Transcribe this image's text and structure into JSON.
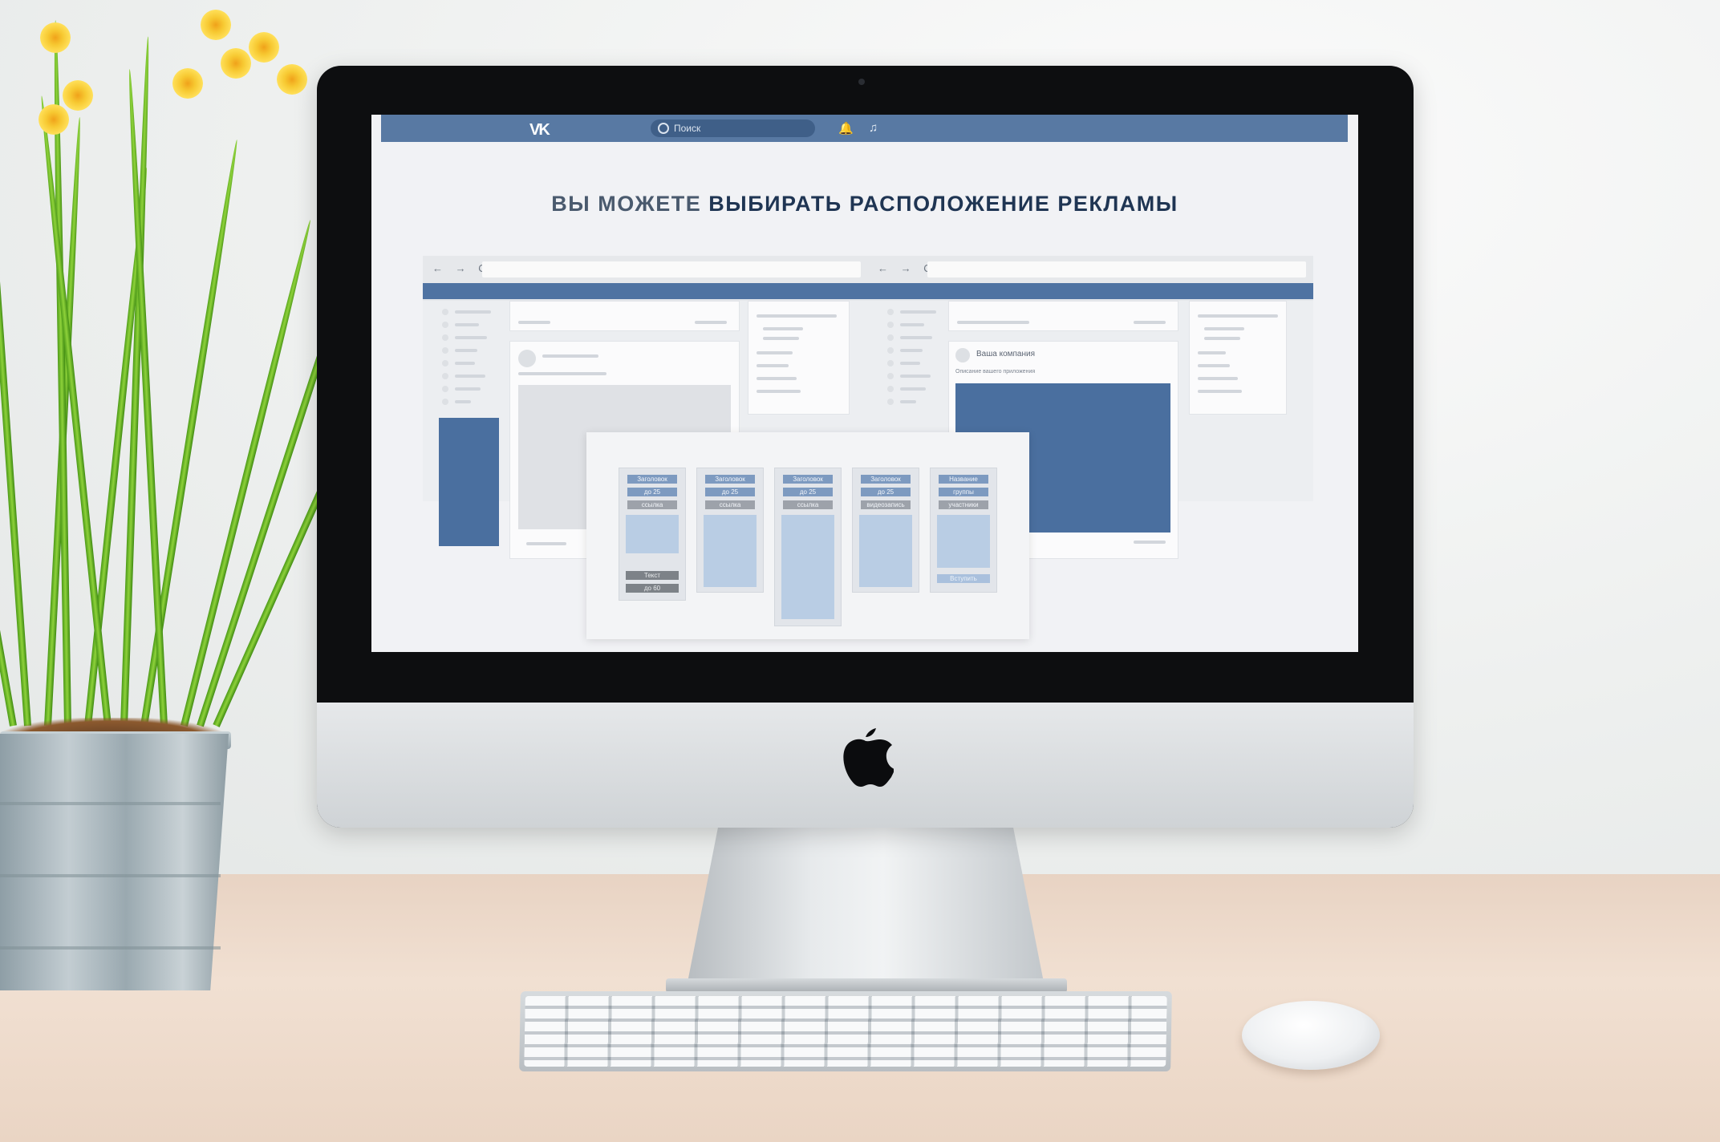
{
  "vk": {
    "logo": "VK",
    "search_placeholder": "Поиск",
    "icons": [
      "bell-icon",
      "music-icon"
    ]
  },
  "headline": {
    "light": "ВЫ МОЖЕТЕ",
    "strong": "ВЫБИРАТЬ РАСПОЛОЖЕНИЕ РЕКЛАМЫ"
  },
  "browser_nav": "← → C",
  "mock_post": {
    "company": "Ваша компания",
    "description": "Описание вашего приложения"
  },
  "ad_formats": [
    {
      "tags": [
        "Заголовок",
        "до 25",
        "ссылка"
      ],
      "buttons": [
        "Текст",
        "до 60"
      ],
      "icon": "image-icon"
    },
    {
      "tags": [
        "Заголовок",
        "до 25",
        "ссылка"
      ],
      "buttons": [],
      "icon": "image-icon"
    },
    {
      "tags": [
        "Заголовок",
        "до 25",
        "ссылка"
      ],
      "buttons": [],
      "icon": "image-icon"
    },
    {
      "tags": [
        "Заголовок",
        "до 25",
        "видеозапись"
      ],
      "buttons": [],
      "icon": "film-icon"
    },
    {
      "tags": [
        "Название",
        "группы",
        "участники"
      ],
      "buttons": [
        "Вступить"
      ],
      "icon": "group-icon"
    }
  ],
  "colors": {
    "vk_blue": "#5879a3",
    "accent_blue": "#4a6f9f",
    "text_dark": "#1f3553"
  }
}
